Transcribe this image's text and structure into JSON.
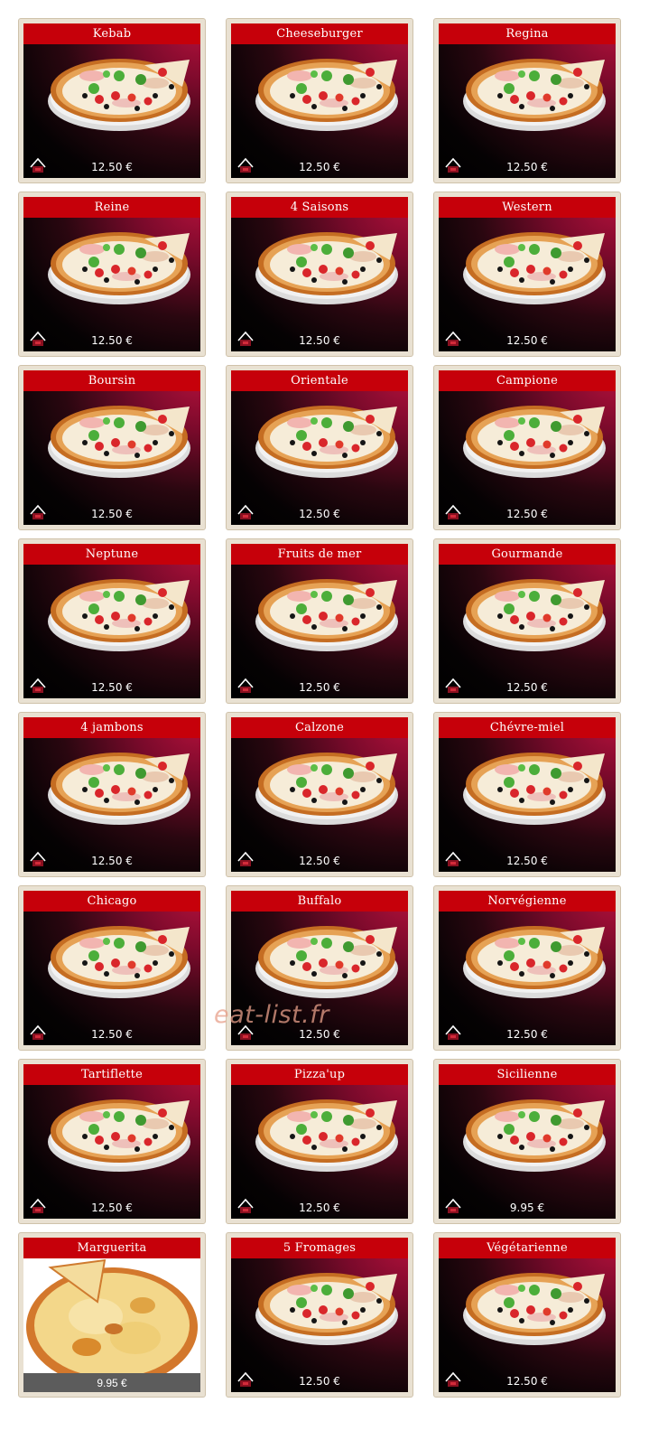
{
  "items": [
    {
      "name": "Kebab",
      "price": "12.50 €"
    },
    {
      "name": "Cheeseburger",
      "price": "12.50 €"
    },
    {
      "name": "Regina",
      "price": "12.50 €"
    },
    {
      "name": "Reine",
      "price": "12.50 €"
    },
    {
      "name": "4 Saisons",
      "price": "12.50 €"
    },
    {
      "name": "Western",
      "price": "12.50 €"
    },
    {
      "name": "Boursin",
      "price": "12.50 €"
    },
    {
      "name": "Orientale",
      "price": "12.50 €"
    },
    {
      "name": "Campione",
      "price": "12.50 €"
    },
    {
      "name": "Neptune",
      "price": "12.50 €"
    },
    {
      "name": "Fruits de mer",
      "price": "12.50 €"
    },
    {
      "name": "Gourmande",
      "price": "12.50 €"
    },
    {
      "name": "4 jambons",
      "price": "12.50 €"
    },
    {
      "name": "Calzone",
      "price": "12.50 €"
    },
    {
      "name": "Chévre-miel",
      "price": "12.50 €"
    },
    {
      "name": "Chicago",
      "price": "12.50 €"
    },
    {
      "name": "Buffalo",
      "price": "12.50 €"
    },
    {
      "name": "Norvégienne",
      "price": "12.50 €"
    },
    {
      "name": "Tartiflette",
      "price": "12.50 €"
    },
    {
      "name": "Pizza'up",
      "price": "12.50 €"
    },
    {
      "name": "Sicilienne",
      "price": "9.95 €"
    },
    {
      "name": "Marguerita",
      "price": "9.95 €",
      "style": "plain"
    },
    {
      "name": "5 Fromages",
      "price": "12.50 €"
    },
    {
      "name": "Végétarienne",
      "price": "12.50 €"
    }
  ],
  "watermark": "eat-list.fr",
  "icons": {
    "pizza": "pizza-photo-icon",
    "logo": "restaurant-logo-icon"
  },
  "colors": {
    "title_bar": "#c6000a",
    "card_frame": "#e9e1d2"
  }
}
